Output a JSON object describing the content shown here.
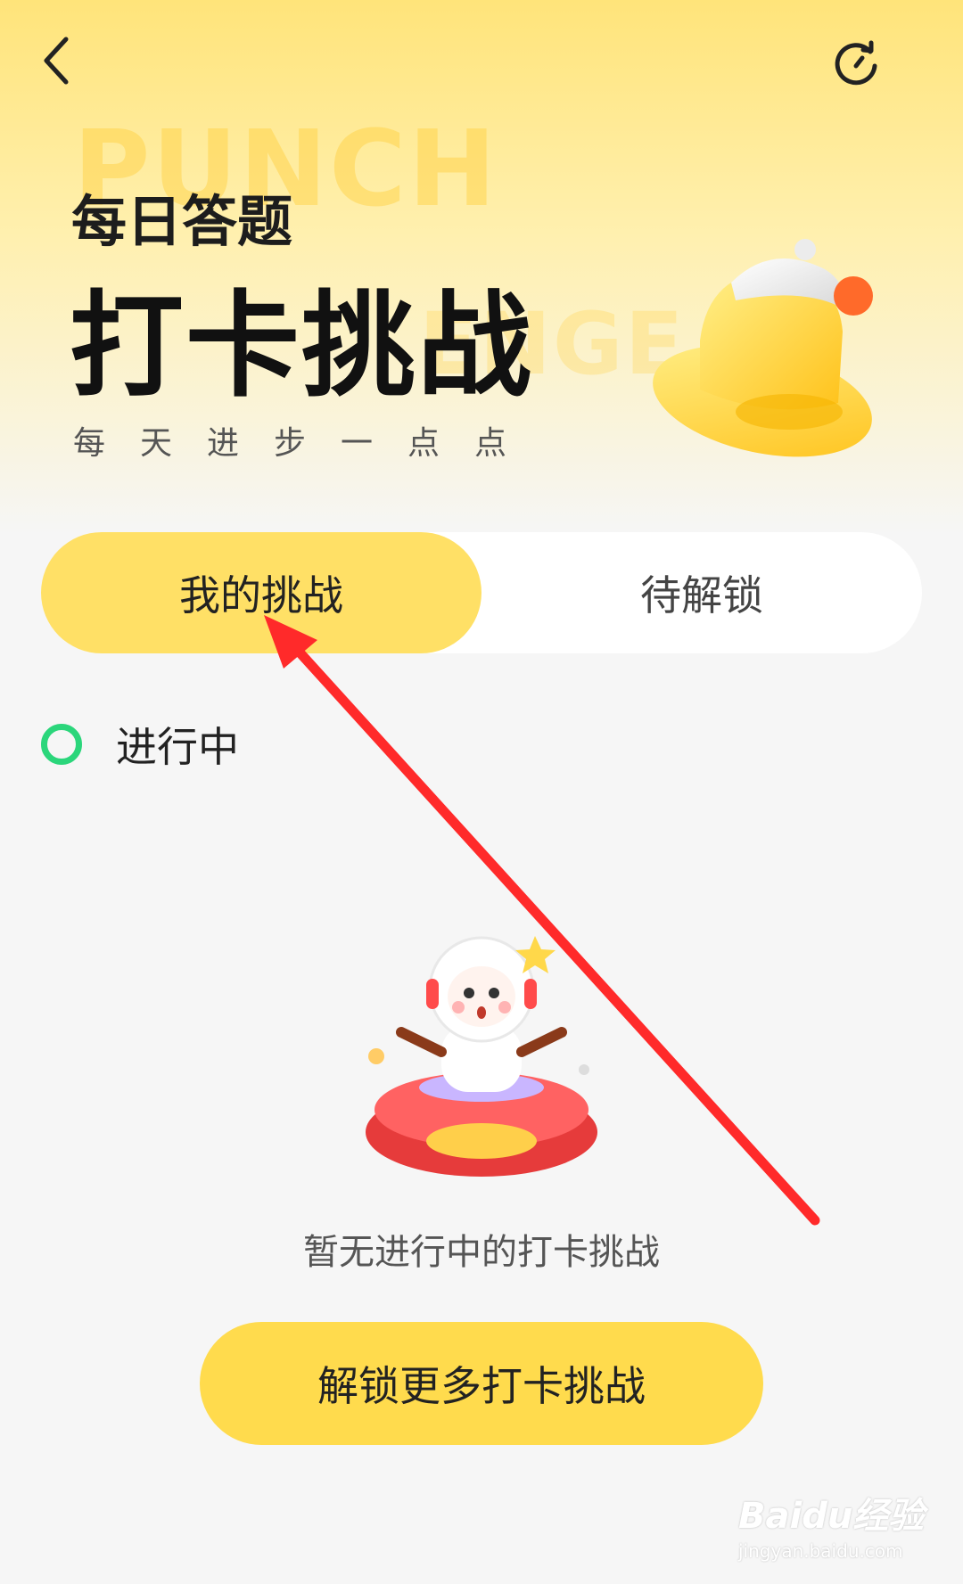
{
  "header": {
    "back_icon": "chevron-left-icon",
    "history_icon": "history-icon"
  },
  "hero": {
    "bg_word_1": "PUNCH",
    "bg_word_2": "ENGE",
    "subtitle": "每日答题",
    "title": "打卡挑战",
    "slogan": "每天进步一点点",
    "illustration": "bell-icon"
  },
  "tabs": [
    {
      "label": "我的挑战",
      "active": true
    },
    {
      "label": "待解锁",
      "active": false
    }
  ],
  "status": {
    "label": "进行中",
    "color": "#2bd67b"
  },
  "empty_state": {
    "illustration": "astronaut-ufo-mascot",
    "text": "暂无进行中的打卡挑战"
  },
  "unlock_button": {
    "label": "解锁更多打卡挑战"
  },
  "annotation_arrow_color": "#ff2a2a",
  "watermark": {
    "main": "Baidu经验",
    "sub": "jingyan.baidu.com"
  },
  "colors": {
    "accent_yellow": "#ffe066",
    "button_yellow": "#ffdb4d",
    "background": "#f6f6f6"
  }
}
